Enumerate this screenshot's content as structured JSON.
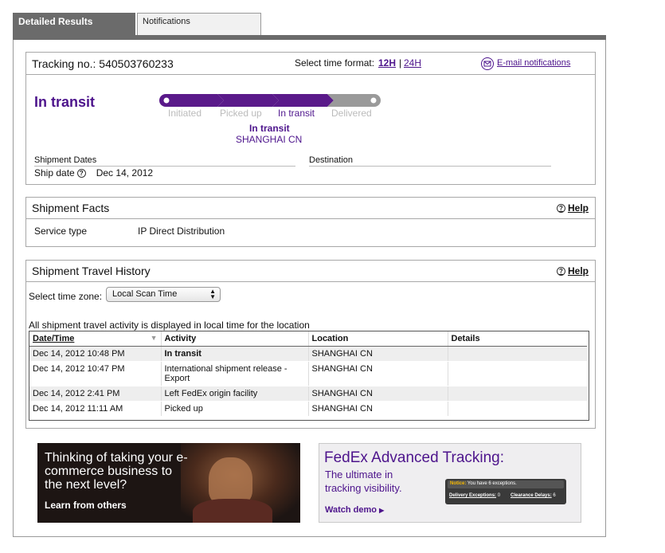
{
  "tabs": {
    "active": "Detailed Results",
    "inactive": "Notifications"
  },
  "tracking": {
    "label": "Tracking no.: 540503760233",
    "time_format_label": "Select time format:",
    "opt_12h": "12H",
    "separator": "|",
    "opt_24h": "24H",
    "email_link": "E-mail notifications",
    "status": "In transit",
    "steps": [
      "Initiated",
      "Picked up",
      "In transit",
      "Delivered"
    ],
    "current_status": "In transit",
    "current_location": "SHANGHAI CN",
    "dates_heading": "Shipment Dates",
    "destination_heading": "Destination",
    "ship_date_label": "Ship date",
    "ship_date_value": "Dec 14, 2012"
  },
  "facts": {
    "title": "Shipment Facts",
    "help": "Help",
    "service_label": "Service type",
    "service_value": "IP Direct Distribution"
  },
  "history": {
    "title": "Shipment Travel History",
    "help": "Help",
    "timezone_label": "Select time zone:",
    "timezone_value": "Local Scan Time",
    "note": "All shipment travel activity is displayed in local time for the location",
    "columns": [
      "Date/Time",
      "Activity",
      "Location",
      "Details"
    ],
    "rows": [
      {
        "date": "Dec 14, 2012 10:48 PM",
        "activity": "In transit",
        "location": "SHANGHAI CN",
        "details": ""
      },
      {
        "date": "Dec 14, 2012 10:47 PM",
        "activity": "International shipment release - Export",
        "location": "SHANGHAI CN",
        "details": ""
      },
      {
        "date": "Dec 14, 2012 2:41 PM",
        "activity": "Left FedEx origin facility",
        "location": "SHANGHAI CN",
        "details": ""
      },
      {
        "date": "Dec 14, 2012 11:11 AM",
        "activity": "Picked up",
        "location": "SHANGHAI CN",
        "details": ""
      }
    ]
  },
  "ad_ecommerce": {
    "headline": "Thinking of taking your e-commerce business to the next level?",
    "cta": "Learn from others"
  },
  "ad_tracking": {
    "title": "FedEx Advanced Tracking:",
    "subtitle_1": "The ultimate in",
    "subtitle_2": "tracking visibility.",
    "cta": "Watch demo",
    "notice_label": "Notice:",
    "notice_text": "You have 6 exceptions.",
    "delivery_exceptions_label": "Delivery Exceptions:",
    "delivery_exceptions_value": "0",
    "clearance_delays_label": "Clearance Delays:",
    "clearance_delays_value": "6"
  },
  "colors": {
    "brand_purple": "#4d148c",
    "tab_gray": "#6b6b6b",
    "row_alt": "#eeeeee"
  }
}
